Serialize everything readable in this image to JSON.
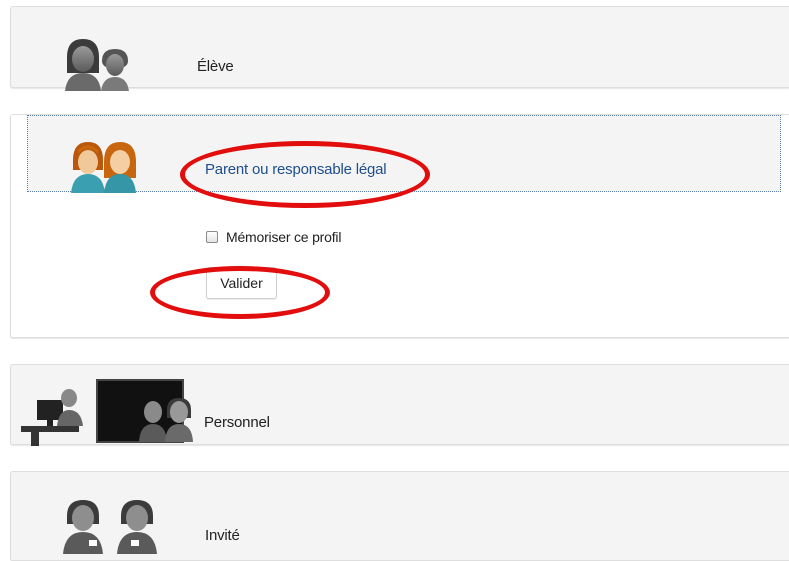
{
  "profiles": [
    {
      "label": "Élève",
      "icon": "student-icon"
    },
    {
      "label": "Parent ou responsable légal",
      "icon": "parent-icon"
    },
    {
      "label": "Personnel",
      "icon": "staff-icon"
    },
    {
      "label": "Invité",
      "icon": "guest-icon"
    }
  ],
  "parent_panel": {
    "remember_label": "Mémoriser ce profil",
    "submit_label": "Valider"
  },
  "colors": {
    "selected_text": "#1e4e8c",
    "annotation_red": "#e20d0d",
    "parent_hair": "#c8650f",
    "parent_body": "#3a9fb0"
  }
}
